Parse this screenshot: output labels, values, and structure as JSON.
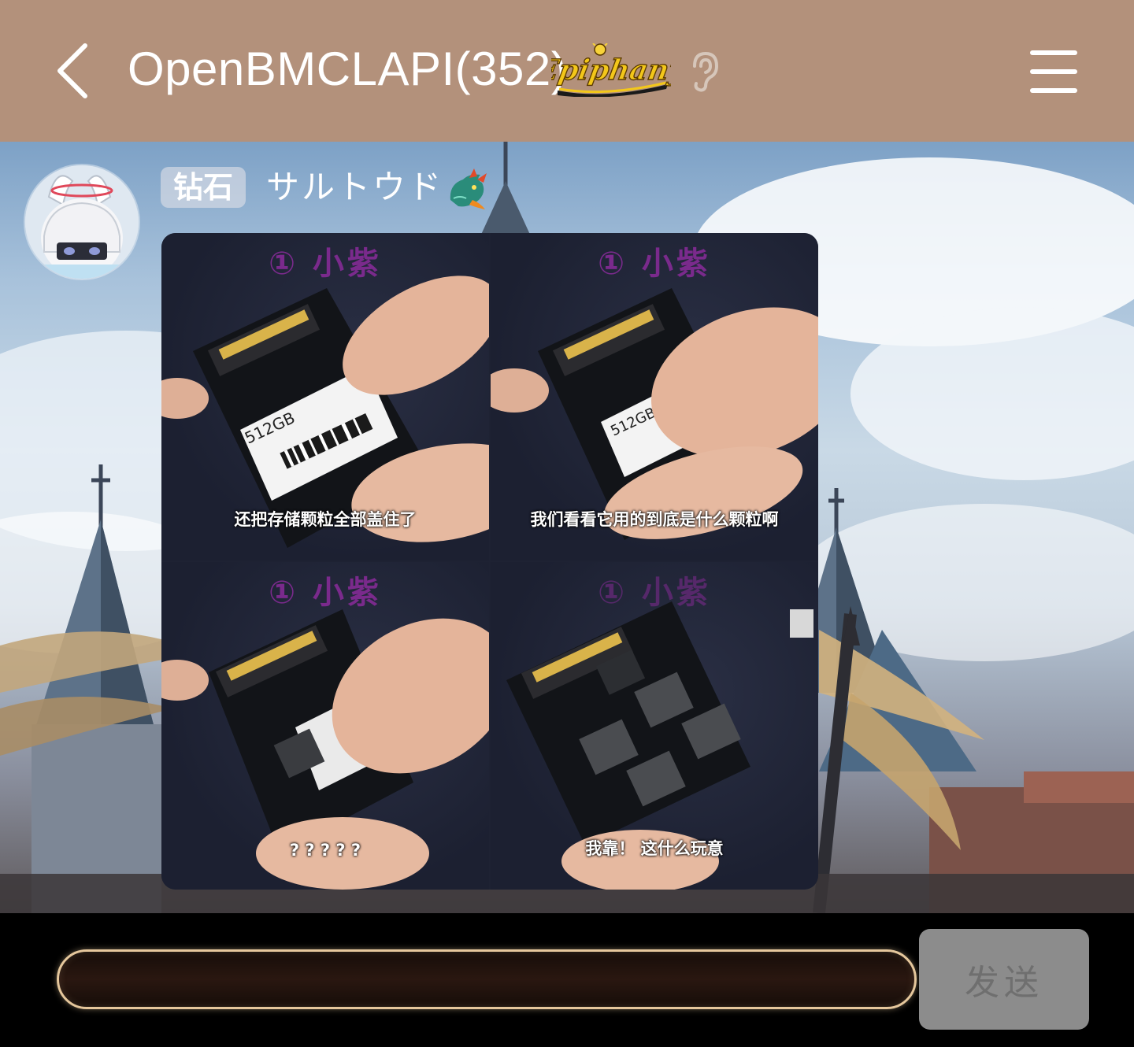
{
  "header": {
    "title": "OpenBMCLAPI(352)",
    "logo_text": "Epiphany",
    "back_icon": "chevron-left-icon",
    "listen_icon": "ear-icon",
    "menu_icon": "hamburger-menu-icon",
    "background_color": "#b3917b"
  },
  "message": {
    "sender": {
      "badge": "钻石",
      "name": "サルトウド",
      "title_icon": "dragon-icon"
    },
    "image": {
      "panels": [
        {
          "title": "① 小紫",
          "caption": "还把存储颗粒全部盖住了",
          "label_text": "512GB"
        },
        {
          "title": "① 小紫",
          "caption": "我们看看它用的到底是什么颗粒啊",
          "label_text": "512GB"
        },
        {
          "title": "① 小紫",
          "caption": "? ? ? ? ?"
        },
        {
          "title": "① 小紫",
          "caption": "我靠！ 这什么玩意"
        }
      ]
    }
  },
  "composer": {
    "input_value": "",
    "send_label": "发送",
    "accent_color": "#e5c79c"
  }
}
